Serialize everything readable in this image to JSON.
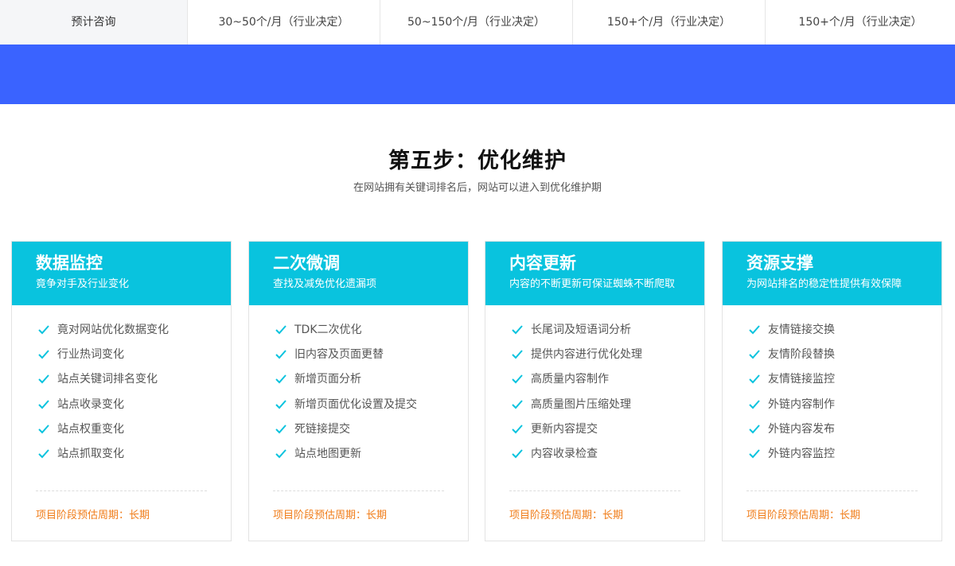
{
  "pricing": {
    "cells": [
      "预计咨询",
      "30~50个/月（行业决定）",
      "50~150个/月（行业决定）",
      "150+个/月（行业决定）",
      "150+个/月（行业决定）"
    ]
  },
  "section": {
    "title": "第五步：优化维护",
    "subtitle": "在网站拥有关键词排名后，网站可以进入到优化维护期"
  },
  "colors": {
    "band": "#3a63ff",
    "card_head": "#09c3de",
    "check": "#09c3de",
    "period": "#f07d1a"
  },
  "cards": [
    {
      "title": "数据监控",
      "desc": "竟争对手及行业变化",
      "items": [
        "竟对网站优化数据变化",
        "行业热词变化",
        "站点关键词排名变化",
        "站点收录变化",
        "站点权重变化",
        "站点抓取变化"
      ],
      "period": "项目阶段预估周期：长期"
    },
    {
      "title": "二次微调",
      "desc": "查找及减免优化遗漏项",
      "items": [
        "TDK二次优化",
        "旧内容及页面更替",
        "新增页面分析",
        "新增页面优化设置及提交",
        "死链接提交",
        "站点地图更新"
      ],
      "period": "项目阶段预估周期：长期"
    },
    {
      "title": "内容更新",
      "desc": "内容的不断更新可保证蜘蛛不断爬取",
      "items": [
        "长尾词及短语词分析",
        "提供内容进行优化处理",
        "高质量内容制作",
        "高质量图片压缩处理",
        "更新内容提交",
        "内容收录检查"
      ],
      "period": "项目阶段预估周期：长期"
    },
    {
      "title": "资源支撑",
      "desc": "为网站排名的稳定性提供有效保障",
      "items": [
        "友情链接交换",
        "友情阶段替换",
        "友情链接监控",
        "外链内容制作",
        "外链内容发布",
        "外链内容监控"
      ],
      "period": "项目阶段预估周期：长期"
    }
  ]
}
